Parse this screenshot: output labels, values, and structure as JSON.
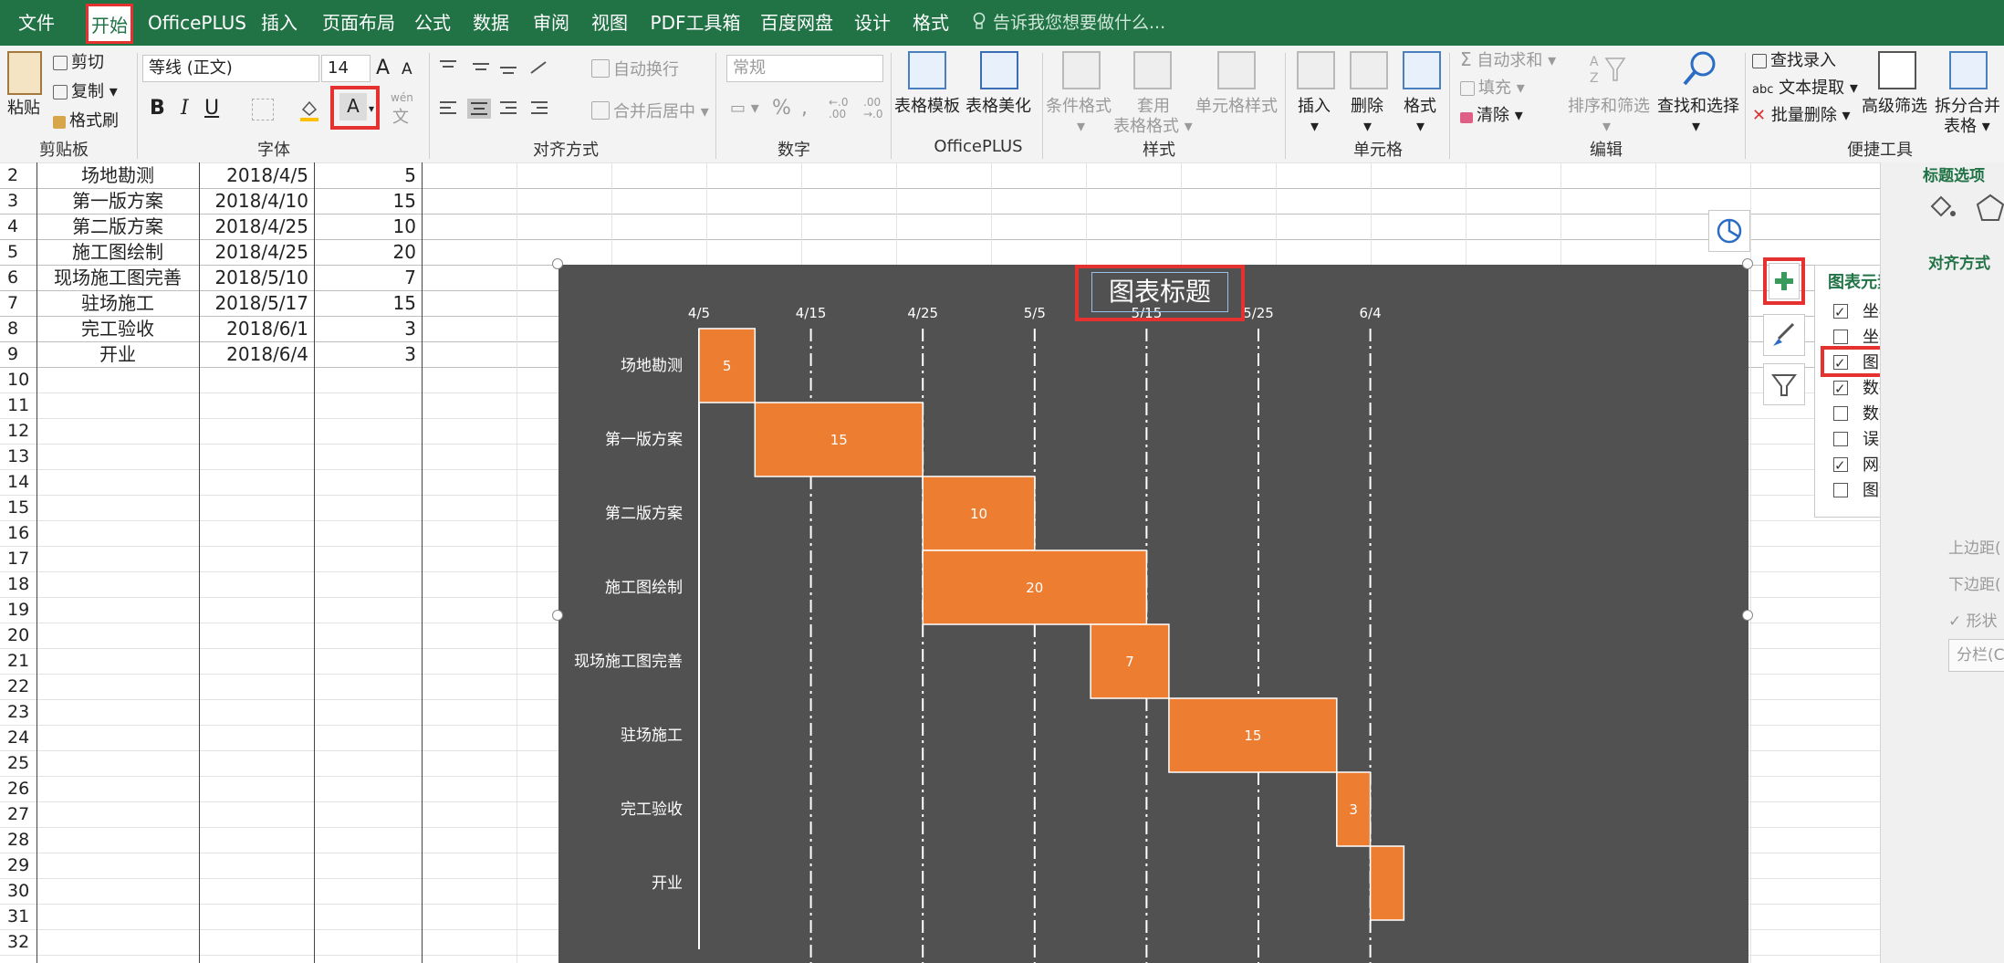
{
  "menu": {
    "tabs": [
      "文件",
      "开始",
      "OfficePLUS",
      "插入",
      "页面布局",
      "公式",
      "数据",
      "审阅",
      "视图",
      "PDF工具箱",
      "百度网盘",
      "设计",
      "格式"
    ],
    "active": "开始",
    "tell_me": "告诉我您想要做什么..."
  },
  "ribbon": {
    "clipboard": {
      "paste": "粘贴",
      "cut": "剪切",
      "copy": "复制",
      "painter": "格式刷",
      "label": "剪贴板"
    },
    "font": {
      "name": "等线 (正文)",
      "size": "14",
      "grow": "A",
      "shrink": "A",
      "bold": "B",
      "italic": "I",
      "underline": "U",
      "color_a": "A",
      "wen": "wén",
      "wen2": "文",
      "label": "字体"
    },
    "align": {
      "wrap": "自动换行",
      "merge": "合并后居中",
      "label": "对齐方式"
    },
    "number": {
      "format": "常规",
      "pct": "%",
      "comma": ",",
      "label": "数字"
    },
    "officeplus": {
      "template": "表格模板",
      "beautify": "表格美化",
      "label": "OfficePLUS"
    },
    "styles": {
      "conditional": "条件格式",
      "table_fmt_1": "套用",
      "table_fmt_2": "表格格式",
      "cell_style": "单元格样式",
      "label": "样式"
    },
    "cells": {
      "insert": "插入",
      "delete": "删除",
      "format": "格式",
      "label": "单元格"
    },
    "edit": {
      "autosum": "自动求和",
      "fill": "填充",
      "clear": "清除",
      "sort": "排序和筛选",
      "find": "查找和选择",
      "label": "编辑"
    },
    "tools": {
      "find_entry": "查找录入",
      "text_extract": "文本提取",
      "batch_delete": "批量删除",
      "adv_filter": "高级筛选",
      "split_1": "拆分合并",
      "split_2": "表格",
      "label": "便捷工具"
    }
  },
  "sheet": {
    "row_numbers": [
      "2",
      "3",
      "4",
      "5",
      "6",
      "7",
      "8",
      "9",
      "10",
      "11",
      "12",
      "13",
      "14",
      "15",
      "16",
      "17",
      "18",
      "19",
      "20",
      "21",
      "22",
      "23",
      "24",
      "25",
      "26",
      "27",
      "28",
      "29",
      "30",
      "31",
      "32"
    ],
    "rows": [
      {
        "task": "场地勘测",
        "date": "2018/4/5",
        "days": "5"
      },
      {
        "task": "第一版方案",
        "date": "2018/4/10",
        "days": "15"
      },
      {
        "task": "第二版方案",
        "date": "2018/4/25",
        "days": "10"
      },
      {
        "task": "施工图绘制",
        "date": "2018/4/25",
        "days": "20"
      },
      {
        "task": "现场施工图完善",
        "date": "2018/5/10",
        "days": "7"
      },
      {
        "task": "驻场施工",
        "date": "2018/5/17",
        "days": "15"
      },
      {
        "task": "完工验收",
        "date": "2018/6/1",
        "days": "3"
      },
      {
        "task": "开业",
        "date": "2018/6/4",
        "days": "3"
      }
    ]
  },
  "chart_data": {
    "type": "bar",
    "title": "图表标题",
    "x_tick_labels": [
      "4/5",
      "4/15",
      "4/25",
      "5/5",
      "5/15",
      "5/25",
      "6/4"
    ],
    "xlim": [
      "2018-04-05",
      "2018-06-07"
    ],
    "categories": [
      "场地勘测",
      "第一版方案",
      "第二版方案",
      "施工图绘制",
      "现场施工图完善",
      "驻场施工",
      "完工验收",
      "开业"
    ],
    "start_dates": [
      "2018-04-05",
      "2018-04-10",
      "2018-04-25",
      "2018-04-25",
      "2018-05-10",
      "2018-05-17",
      "2018-06-01",
      "2018-06-04"
    ],
    "values": [
      5,
      15,
      10,
      20,
      7,
      15,
      3,
      3
    ],
    "data_labels": [
      "5",
      "15",
      "10",
      "20",
      "7",
      "15",
      "3",
      ""
    ],
    "grid": true,
    "bar_color": "#ed7d31",
    "background": "#515151"
  },
  "chart_elements": {
    "header": "图表元素",
    "items": [
      {
        "label": "坐标轴",
        "checked": true
      },
      {
        "label": "坐标轴标题",
        "checked": false
      },
      {
        "label": "图表标题",
        "checked": true
      },
      {
        "label": "数据标签",
        "checked": true
      },
      {
        "label": "数据表",
        "checked": false
      },
      {
        "label": "误差线",
        "checked": false
      },
      {
        "label": "网格线",
        "checked": true
      },
      {
        "label": "图例",
        "checked": false
      }
    ]
  },
  "side_pane": {
    "title": "标题选项",
    "align_section": "对齐方式",
    "top_margin": "上边距(",
    "bottom_margin": "下边距(",
    "shape": "形状",
    "columns": "分栏(C"
  }
}
